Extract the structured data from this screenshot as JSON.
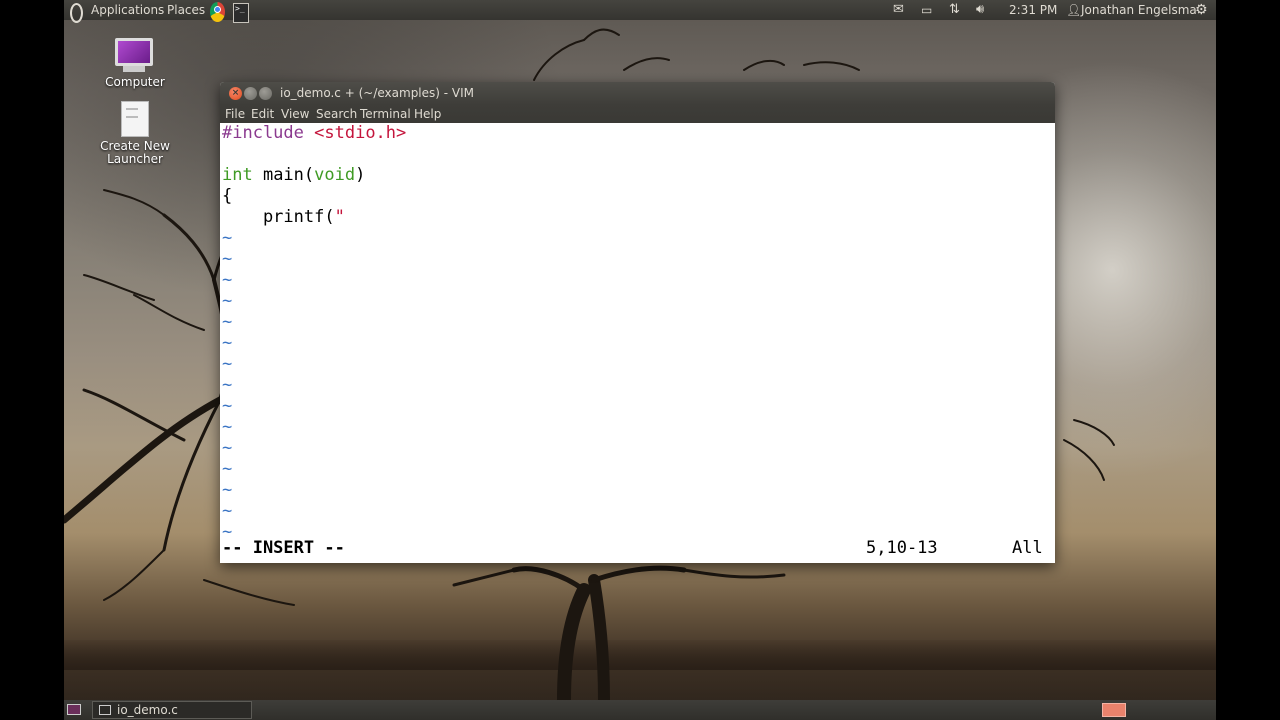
{
  "top_panel": {
    "applications_label": "Applications",
    "places_label": "Places",
    "clock": "2:31 PM",
    "user_name": "Jonathan Engelsma"
  },
  "desktop": {
    "icons": [
      {
        "label": "Computer"
      },
      {
        "label": "Create New Launcher"
      }
    ]
  },
  "vim": {
    "title": "io_demo.c + (~/examples) - VIM",
    "menu": [
      "File",
      "Edit",
      "View",
      "Search",
      "Terminal",
      "Help"
    ],
    "code": {
      "include_directive": "#include",
      "include_header": "<stdio.h>",
      "main_type": "int",
      "main_name": " main(",
      "main_param": "void",
      "main_close": ")",
      "open_brace": "{",
      "printf_call": "    printf(",
      "printf_quote": "\""
    },
    "tilde": "~",
    "tilde_count": 15,
    "status": {
      "mode": "-- INSERT --",
      "ruler": "5,10-13",
      "position": "All"
    }
  },
  "bottom_panel": {
    "task_label": "io_demo.c"
  },
  "colors": {
    "preprocessor": "#8b3a8f",
    "string": "#c4153c",
    "type": "#3f9b24",
    "tilde": "#3a74c4",
    "panel": "#3c3b37"
  }
}
